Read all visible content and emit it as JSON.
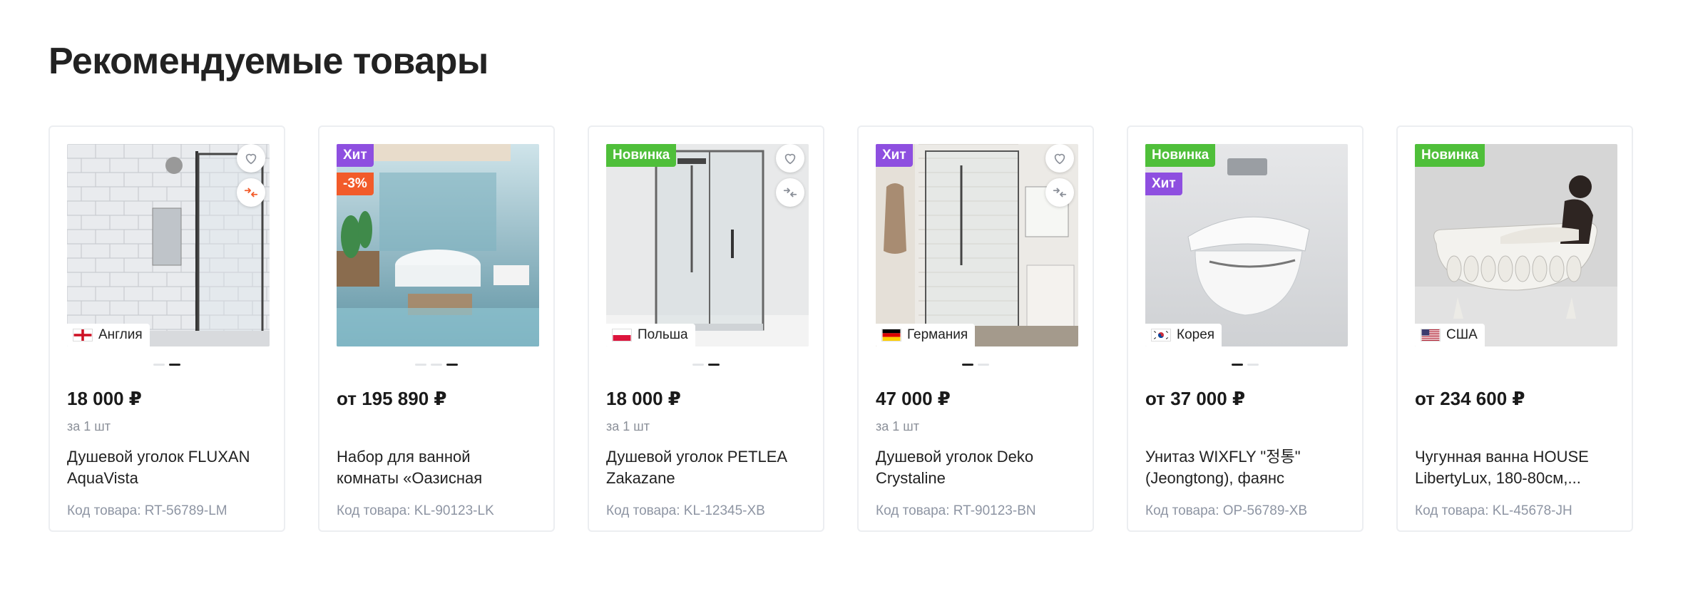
{
  "page": {
    "title": "Рекомендуемые товары"
  },
  "colors": {
    "badge_new": "#4fbf3a",
    "badge_hit": "#8e4fe0",
    "badge_sale": "#f25b2a",
    "sku_text": "#8e95a3"
  },
  "products": [
    {
      "badges": [],
      "country": "Англия",
      "flag": "england",
      "price": "18 000 ₽",
      "unit": "за 1 шт",
      "name": "Душевой уголок FLUXAN AquaVista",
      "sku": "Код товара: RT-56789-LM",
      "has_actions": true,
      "compare_active": true,
      "dots": 2,
      "active_dot": 2,
      "image": "shower-enclosure-tiles"
    },
    {
      "badges": [
        {
          "text": "Хит",
          "kind": "hit"
        },
        {
          "text": "-3%",
          "kind": "sale"
        }
      ],
      "country": "",
      "flag": "",
      "price": "от 195 890 ₽",
      "unit": "",
      "name": "Набор для ванной комнаты «Оазисная Ванная»",
      "sku": "Код товара: KL-90123-LK",
      "has_actions": false,
      "compare_active": false,
      "dots": 3,
      "active_dot": 3,
      "image": "bathroom-set"
    },
    {
      "badges": [
        {
          "text": "Новинка",
          "kind": "new"
        }
      ],
      "country": "Польша",
      "flag": "poland",
      "price": "18 000 ₽",
      "unit": "за 1 шт",
      "name": "Душевой уголок PETLEA Zakazane",
      "sku": "Код товара: KL-12345-XB",
      "has_actions": true,
      "compare_active": false,
      "dots": 2,
      "active_dot": 2,
      "image": "glass-shower"
    },
    {
      "badges": [
        {
          "text": "Хит",
          "kind": "hit"
        }
      ],
      "country": "Германия",
      "flag": "germany",
      "price": "47 000 ₽",
      "unit": "за 1 шт",
      "name": "Душевой уголок Deko Crystaline",
      "sku": "Код товара: RT-90123-BN",
      "has_actions": true,
      "compare_active": false,
      "dots": 2,
      "active_dot": 1,
      "image": "shower-room"
    },
    {
      "badges": [
        {
          "text": "Новинка",
          "kind": "new"
        },
        {
          "text": "Хит",
          "kind": "hit"
        }
      ],
      "country": "Корея",
      "flag": "korea",
      "price": "от 37 000 ₽",
      "unit": "",
      "name": "Унитаз WIXFLY \"정통\" (Jeongtong), фаянс",
      "sku": "Код товара: OP-56789-XB",
      "has_actions": false,
      "compare_active": false,
      "dots": 2,
      "active_dot": 1,
      "image": "wall-toilet"
    },
    {
      "badges": [
        {
          "text": "Новинка",
          "kind": "new"
        }
      ],
      "country": "США",
      "flag": "usa",
      "price": "от 234 600 ₽",
      "unit": "",
      "name": "Чугунная ванна HOUSE LibertyLux, 180-80см,...",
      "sku": "Код товара: KL-45678-JH",
      "has_actions": false,
      "compare_active": false,
      "dots": 0,
      "active_dot": 0,
      "image": "clawfoot-bathtub"
    }
  ]
}
